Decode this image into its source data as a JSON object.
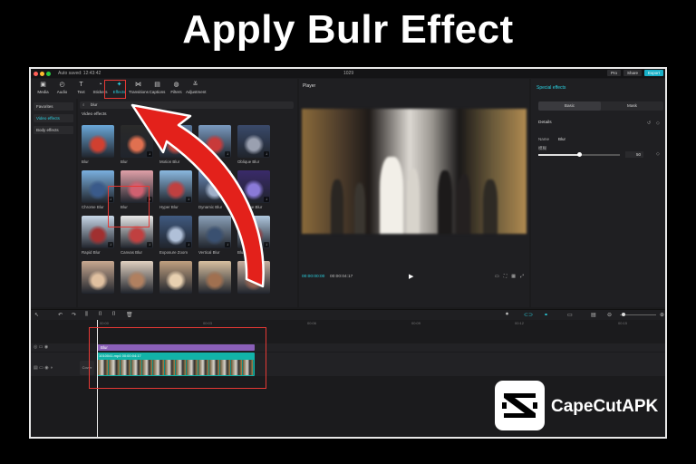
{
  "headline": "Apply Bulr Effect",
  "titlebar": {
    "autosave": "Auto saved: 12:43:42",
    "project": "1029",
    "pro_label": "Pro",
    "share_label": "Share",
    "export_label": "Export"
  },
  "media_tools": [
    {
      "label": "Media",
      "icon": "media-icon"
    },
    {
      "label": "Audio",
      "icon": "audio-icon"
    },
    {
      "label": "Text",
      "icon": "text-icon"
    },
    {
      "label": "Stickers",
      "icon": "sticker-icon"
    },
    {
      "label": "Effects",
      "icon": "effects-icon",
      "active": true
    },
    {
      "label": "Transitions",
      "icon": "transition-icon"
    },
    {
      "label": "Captions",
      "icon": "captions-icon"
    },
    {
      "label": "Filters",
      "icon": "filter-icon"
    },
    {
      "label": "Adjustment",
      "icon": "adjust-icon"
    }
  ],
  "categories": [
    "Favorites",
    "Video effects",
    "Body effects"
  ],
  "search": {
    "value": "blur"
  },
  "library": {
    "section": "Video effects",
    "items": [
      {
        "label": "Blur"
      },
      {
        "label": "Blur"
      },
      {
        "label": "Motion Blur"
      },
      {
        "label": "Blur"
      },
      {
        "label": "Oblique Blur"
      },
      {
        "label": "Chrome Blur"
      },
      {
        "label": "Blur"
      },
      {
        "label": "Hyper Blur"
      },
      {
        "label": "Dynamic Blur"
      },
      {
        "label": "Blue Line Blur"
      },
      {
        "label": "Rapid Blur"
      },
      {
        "label": "Canvas Blur"
      },
      {
        "label": "Exposure Zoom"
      },
      {
        "label": "Vertical Blur"
      },
      {
        "label": "Blur"
      },
      {
        "label": ""
      },
      {
        "label": ""
      },
      {
        "label": ""
      },
      {
        "label": ""
      },
      {
        "label": ""
      }
    ]
  },
  "player": {
    "title": "Player",
    "time_current": "00:00:00:00",
    "time_total": "00:00:04:17"
  },
  "special": {
    "title": "Special effects",
    "tabs": [
      "Basic",
      "Mask"
    ],
    "details_label": "Details",
    "name_label": "Name",
    "name_value": "Blur",
    "param_label": "模糊",
    "param_value": "50",
    "param_fraction": 0.5
  },
  "ruler": [
    "00:00",
    "00:03",
    "00:06",
    "00:09",
    "00:12",
    "00:15"
  ],
  "timeline": {
    "fx_clip_label": "Blur",
    "video_clip_name": "1010041.mp4",
    "video_clip_duration": "00:00:04:17",
    "cover_label": "Cover"
  },
  "brand": {
    "name": "CapeCutAPK"
  },
  "colors": {
    "accent": "#2ad0e0",
    "highlight": "#e53935",
    "fx_clip": "#8a5fb8",
    "video_clip": "#12b3a8"
  }
}
